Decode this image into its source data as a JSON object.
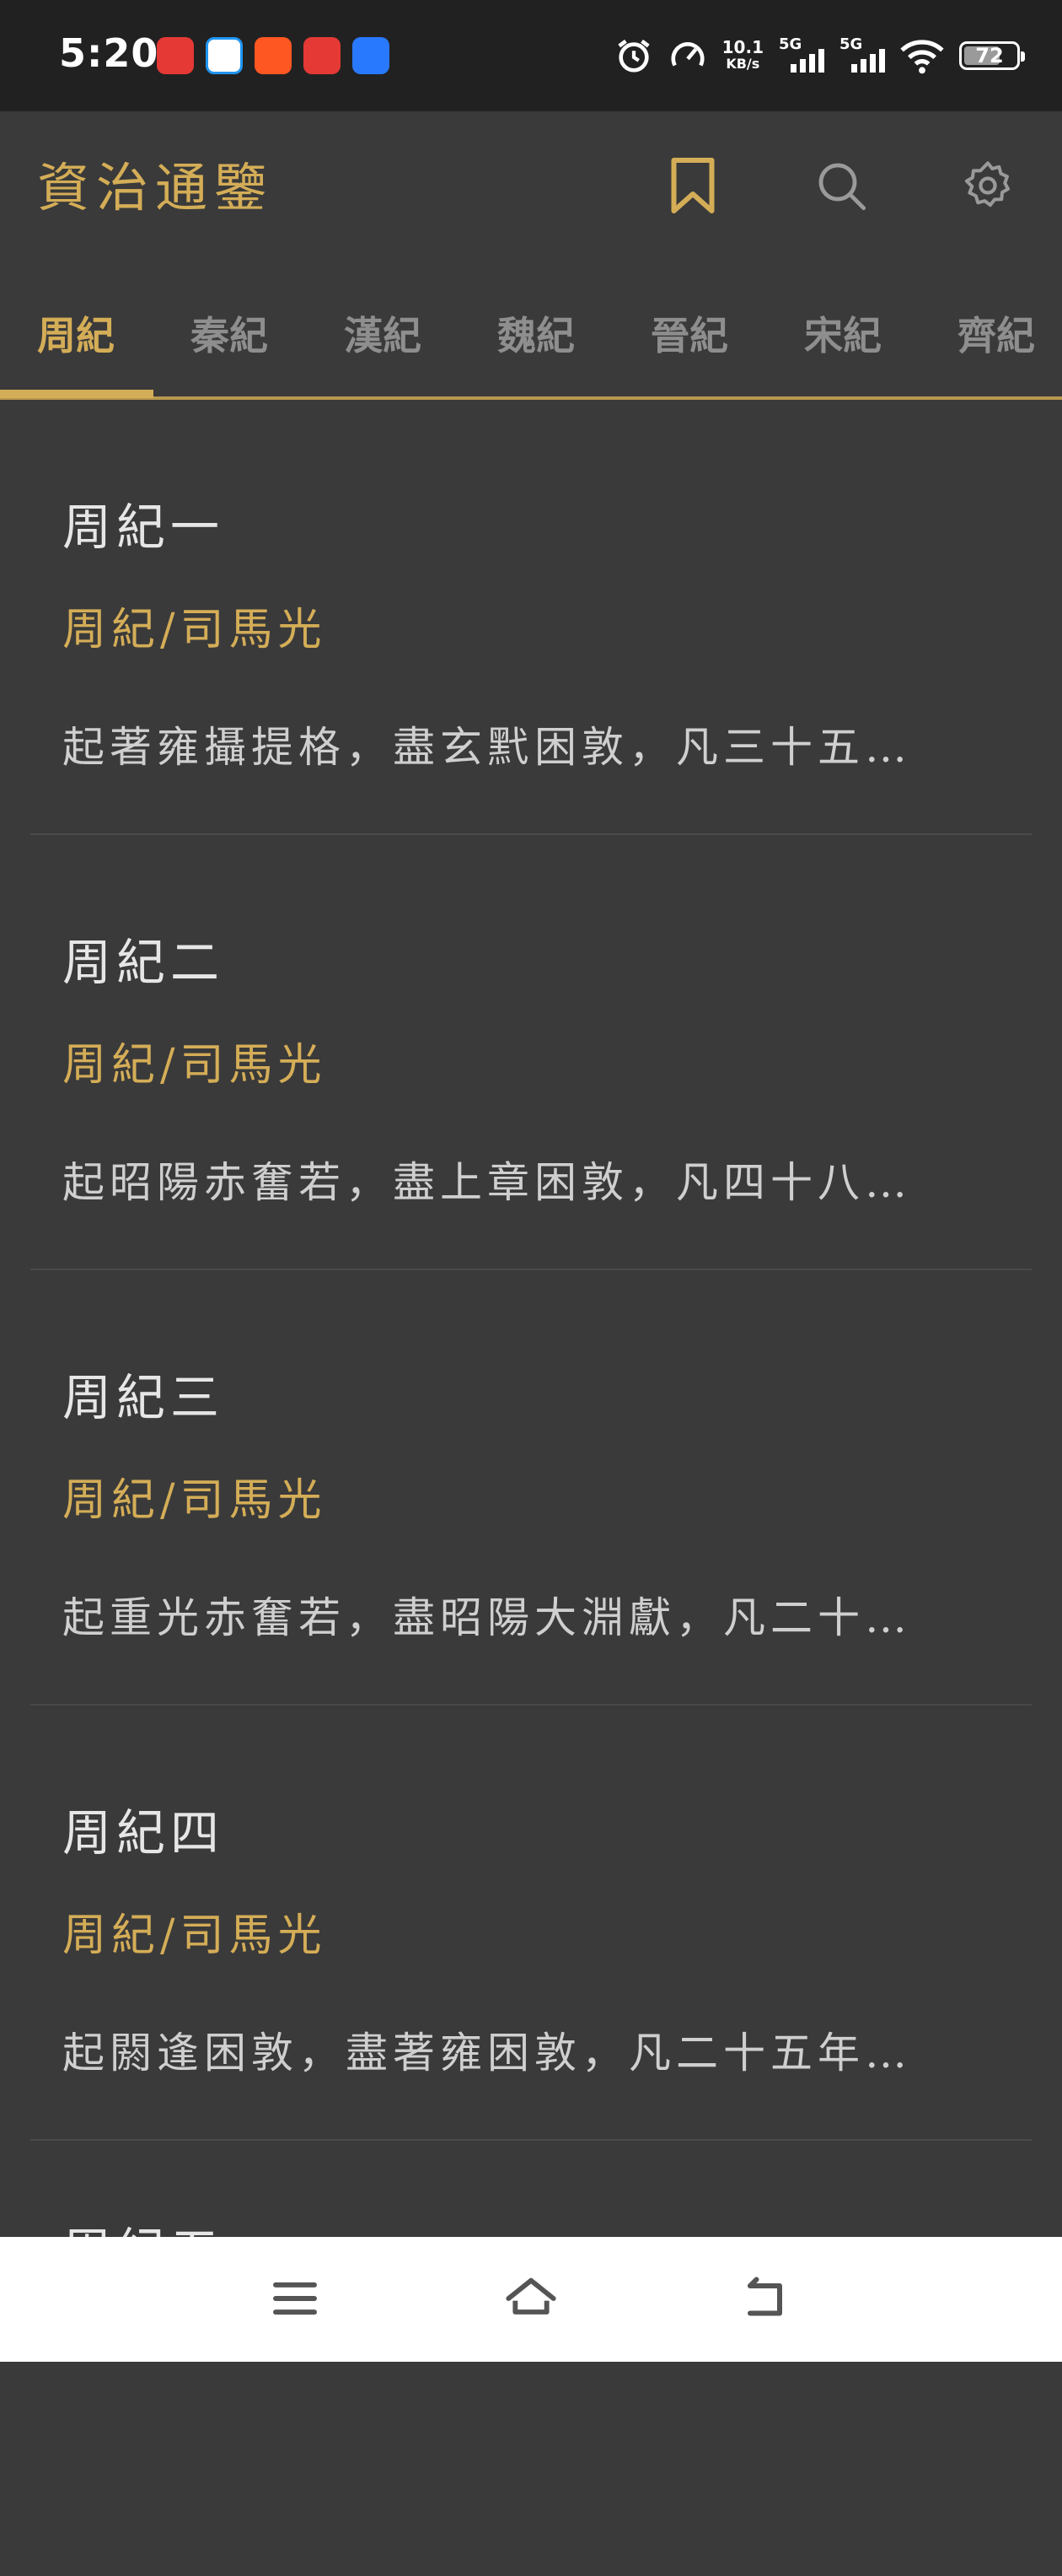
{
  "status_bar": {
    "time": "5:20",
    "net_speed_value": "10.1",
    "net_speed_unit": "KB/s",
    "sim1_label": "5G",
    "sim2_label": "5G",
    "battery_level": "72",
    "notification_icons": [
      "app-icon-red",
      "app-icon-blue",
      "app-icon-orange",
      "app-icon-red",
      "app-icon-blue-round"
    ],
    "system_icons": [
      "alarm-icon",
      "speedometer-icon",
      "signal-icon",
      "signal-icon",
      "wifi-icon",
      "battery-icon"
    ]
  },
  "header": {
    "title": "資治通鑒",
    "actions": [
      "bookmark-icon",
      "search-icon",
      "gear-icon"
    ]
  },
  "tabs": [
    {
      "label": "周紀",
      "active": true
    },
    {
      "label": "秦紀",
      "active": false
    },
    {
      "label": "漢紀",
      "active": false
    },
    {
      "label": "魏紀",
      "active": false
    },
    {
      "label": "晉紀",
      "active": false
    },
    {
      "label": "宋紀",
      "active": false
    },
    {
      "label": "齊紀",
      "active": false
    }
  ],
  "chapters": [
    {
      "title": "周紀一",
      "author": "周紀/司馬光",
      "desc": "起著雍攝提格，盡玄黓困敦，凡三十五…"
    },
    {
      "title": "周紀二",
      "author": "周紀/司馬光",
      "desc": "起昭陽赤奮若，盡上章困敦，凡四十八…"
    },
    {
      "title": "周紀三",
      "author": "周紀/司馬光",
      "desc": "起重光赤奮若，盡昭陽大淵獻，凡二十…"
    },
    {
      "title": "周紀四",
      "author": "周紀/司馬光",
      "desc": "起閼逢困敦，盡著雍困敦，凡二十五年…"
    },
    {
      "title": "周紀五",
      "author": "",
      "desc": ""
    }
  ],
  "nav_bar": [
    "menu-icon",
    "home-icon",
    "back-icon"
  ],
  "colors": {
    "accent": "#d4ad57",
    "background": "#3a3a3a",
    "status_bar": "#212121",
    "tab_inactive": "#8e8e8e",
    "title_text": "#e6e6e6",
    "desc_text": "#cfcfcf"
  }
}
